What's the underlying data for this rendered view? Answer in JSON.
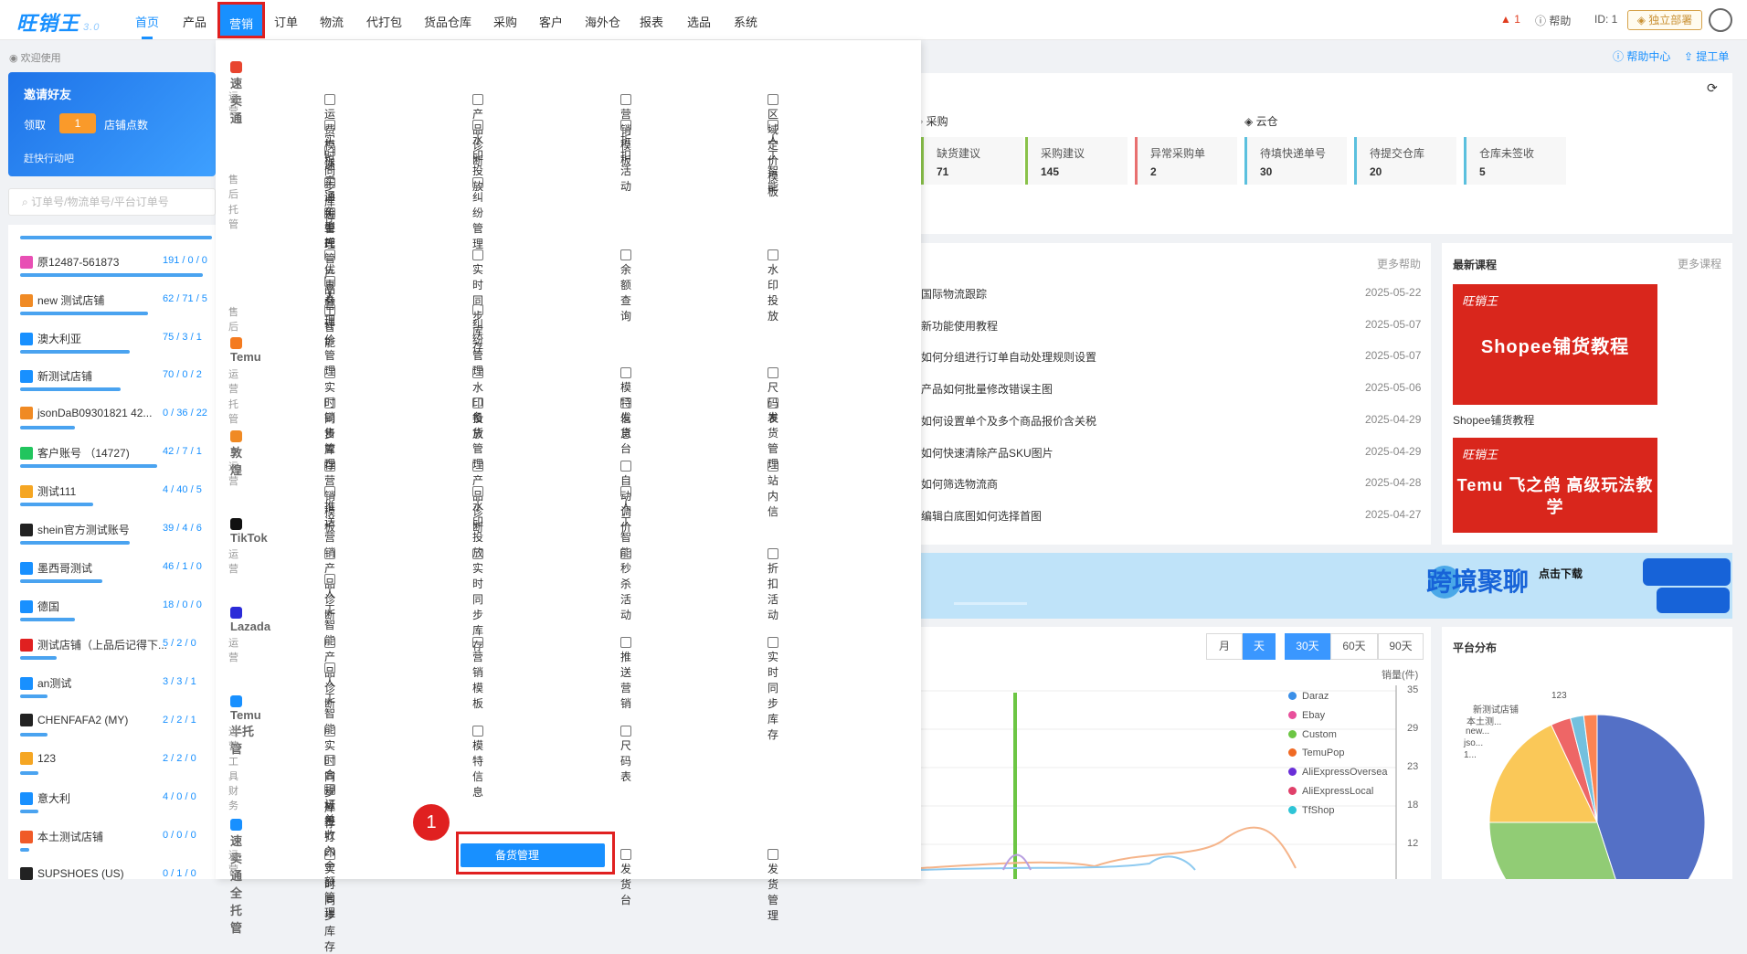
{
  "app": {
    "logo": "旺销王",
    "version": "3.0"
  },
  "nav": {
    "items": [
      "首页",
      "产品",
      "营销",
      "订单",
      "物流",
      "代打包",
      "货品仓库",
      "采购",
      "客户",
      "海外仓",
      "报表",
      "选品",
      "系统"
    ],
    "active": "首页",
    "highlighted": "营销"
  },
  "topright": {
    "alert_count": "1",
    "help": "帮助",
    "id": "ID: 1",
    "deploy": "独立部署"
  },
  "sidebar": {
    "welcome": "欢迎使用",
    "invite": {
      "title": "邀请好友",
      "receive": "领取",
      "count": "1",
      "unit": "店铺点数",
      "cta": "赶快行动吧"
    },
    "search_placeholder": "订单号/物流单号/平台订单号",
    "shops": [
      {
        "name": "原12487-561873",
        "counts": "191 / 0 / 0",
        "color": "#e84fb4"
      },
      {
        "name": "new 测试店铺",
        "counts": "62 / 71 / 5",
        "color": "#f08a24"
      },
      {
        "name": "澳大利亚",
        "counts": "75 / 3 / 1",
        "color": "#1890ff"
      },
      {
        "name": "新测试店铺",
        "counts": "70 / 0 / 2",
        "color": "#1890ff"
      },
      {
        "name": "jsonDaB09301821 42...",
        "counts": "0 / 36 / 22",
        "color": "#f08a24"
      },
      {
        "name": "客户账号 （14727)",
        "counts": "42 / 7 / 1",
        "color": "#22c55e"
      },
      {
        "name": "测试111",
        "counts": "4 / 40 / 5",
        "color": "#f5a623"
      },
      {
        "name": "shein官方测试账号",
        "counts": "39 / 4 / 6",
        "color": "#222222"
      },
      {
        "name": "墨西哥测试",
        "counts": "46 / 1 / 0",
        "color": "#1890ff"
      },
      {
        "name": "德国",
        "counts": "18 / 0 / 0",
        "color": "#1890ff"
      },
      {
        "name": "测试店铺（上品后记得下...",
        "counts": "5 / 2 / 0",
        "color": "#e02020"
      },
      {
        "name": "an测试",
        "counts": "3 / 3 / 1",
        "color": "#1890ff"
      },
      {
        "name": "CHENFAFA2 (MY)",
        "counts": "2 / 2 / 1",
        "color": "#222222"
      },
      {
        "name": "123",
        "counts": "2 / 2 / 0",
        "color": "#f5a623"
      },
      {
        "name": "意大利",
        "counts": "4 / 0 / 0",
        "color": "#1890ff"
      },
      {
        "name": "本土测试店铺",
        "counts": "0 / 0 / 0",
        "color": "#f05a28"
      },
      {
        "name": "SUPSHOES (US)",
        "counts": "0 / 1 / 0",
        "color": "#222222"
      }
    ]
  },
  "menu": {
    "sections": [
      {
        "title": "速卖通",
        "color": "#e8452f",
        "groups": [
          {
            "cat": "运营",
            "items": [
              "运费模板",
              "产品诊断",
              "营销模板",
              "区域定价模板",
              "实时同步库存",
              "水印投放",
              "折扣活动",
              "人工智能",
              "速卖通车型库"
            ]
          },
          {
            "cat": "售后",
            "items": [
              "评价管理",
              "纠纷管理"
            ]
          },
          {
            "cat": "托管",
            "items": [
              "半托管产品管理"
            ]
          }
        ]
      },
      {
        "title": "",
        "groups": [
          {
            "cat": "",
            "items": [
              "优惠券",
              "实时同步库存",
              "余额查询",
              "水印投放",
              "人工智能"
            ]
          },
          {
            "cat": "售后",
            "items": [
              "评价管理",
              "纠纷管理"
            ]
          }
        ]
      },
      {
        "title": "Temu",
        "color": "#f47b20",
        "groups": [
          {
            "cat": "运营",
            "items": [
              "实时同步库存",
              "水印投放",
              "模特信息",
              "尺码表"
            ]
          },
          {
            "cat": "托管",
            "items": [
              "销售管理",
              "备货管理",
              "发货台",
              "发货管理"
            ]
          }
        ]
      },
      {
        "title": "敦煌",
        "color": "#f08a24",
        "groups": [
          {
            "cat": "运营",
            "items": [
              "营销模板",
              "产品诊断",
              "自动调价",
              "站内信",
              "推送营销",
              "水印投放",
              "人工智能"
            ]
          }
        ]
      },
      {
        "title": "TikTok",
        "color": "#111111",
        "groups": [
          {
            "cat": "运营",
            "items": [
              "产品诊断",
              "实时同步库存",
              "秒杀活动",
              "折扣活动",
              "人工智能"
            ]
          }
        ]
      },
      {
        "title": "Lazada",
        "color": "#2b2bd8",
        "groups": [
          {
            "cat": "运营",
            "items": [
              "产品诊断",
              "营销模板",
              "推送营销",
              "实时同步库存",
              "人工智能"
            ]
          }
        ]
      },
      {
        "title": "Temu半托管",
        "color": "#1890ff",
        "groups": [
          {
            "cat": "运营",
            "items": [
              "实时同步库存",
              "模特信息",
              "尺码表"
            ]
          },
          {
            "cat": "工具",
            "items": [
              "合规标签打印"
            ]
          },
          {
            "cat": "财务",
            "items": [
              "订单收入金额管理"
            ]
          }
        ]
      },
      {
        "title": "速卖通全托管",
        "color": "#1890ff",
        "groups": [
          {
            "cat": "运营",
            "items": [
              "实时同步库存",
              "备货管理",
              "发货台",
              "发货管理"
            ]
          }
        ]
      }
    ],
    "selected": "备货管理",
    "step_badge": "1"
  },
  "dashboard": {
    "help_center": "帮助中心",
    "ticket": "提工单",
    "purchase_title": "采购",
    "cloud_title": "云仓",
    "stats": [
      {
        "label": "缺货建议",
        "value": "71",
        "color": "#8ac24a"
      },
      {
        "label": "采购建议",
        "value": "145",
        "color": "#8ac24a"
      },
      {
        "label": "异常采购单",
        "value": "2",
        "color": "#e87070"
      },
      {
        "label": "待填快递单号",
        "value": "30",
        "color": "#5bc0de"
      },
      {
        "label": "待提交仓库",
        "value": "20",
        "color": "#5bc0de"
      },
      {
        "label": "仓库未签收",
        "value": "5",
        "color": "#5bc0de"
      }
    ],
    "help_more": "更多帮助",
    "news": [
      {
        "title": "国际物流跟踪",
        "date": "2025-05-22"
      },
      {
        "title": "新功能使用教程",
        "date": "2025-05-07"
      },
      {
        "title": "如何分组进行订单自动处理规则设置",
        "date": "2025-05-07"
      },
      {
        "title": "产品如何批量修改错误主图",
        "date": "2025-05-06"
      },
      {
        "title": "如何设置单个及多个商品报价含关税",
        "date": "2025-04-29"
      },
      {
        "title": "如何快速清除产品SKU图片",
        "date": "2025-04-29"
      },
      {
        "title": "如何筛选物流商",
        "date": "2025-04-28"
      },
      {
        "title": "编辑白底图如何选择首图",
        "date": "2025-04-27"
      }
    ],
    "courses_title": "最新课程",
    "courses_more": "更多课程",
    "courses": [
      {
        "banner": "Shopee铺货教程",
        "caption": "Shopee铺货教程"
      },
      {
        "banner": "Temu 飞之鸽 高级玩法教学",
        "caption": ""
      }
    ],
    "ad": {
      "title": "跨境聚聊",
      "cta": "点击下载"
    },
    "range_buttons": [
      "月",
      "天",
      "30天",
      "60天",
      "90天"
    ],
    "range_active": [
      "天",
      "30天"
    ],
    "platform_title": "平台分布"
  },
  "chart_data": [
    {
      "type": "line",
      "ylabel": "销量(件)",
      "yticks": [
        35,
        29,
        23,
        18,
        12
      ],
      "series": [
        {
          "name": "Daraz",
          "color": "#3a8fe8"
        },
        {
          "name": "Ebay",
          "color": "#e84f9b"
        },
        {
          "name": "Custom",
          "color": "#6cc644"
        },
        {
          "name": "TemuPop",
          "color": "#f06a24"
        },
        {
          "name": "AliExpressOversea",
          "color": "#6a2fd8"
        },
        {
          "name": "AliExpressLocal",
          "color": "#e0406a"
        },
        {
          "name": "TfShop",
          "color": "#2ec4d6"
        }
      ]
    },
    {
      "type": "pie",
      "labels": [
        "123",
        "新测试店铺",
        "本土测...",
        "new...",
        "jso...",
        "1..."
      ],
      "slices": [
        {
          "value": 45,
          "color": "#5470c6"
        },
        {
          "value": 30,
          "color": "#91cc75"
        },
        {
          "value": 18,
          "color": "#fac858"
        },
        {
          "value": 3,
          "color": "#ee6666"
        },
        {
          "value": 2,
          "color": "#73c0de"
        },
        {
          "value": 2,
          "color": "#fc8452"
        }
      ]
    }
  ]
}
